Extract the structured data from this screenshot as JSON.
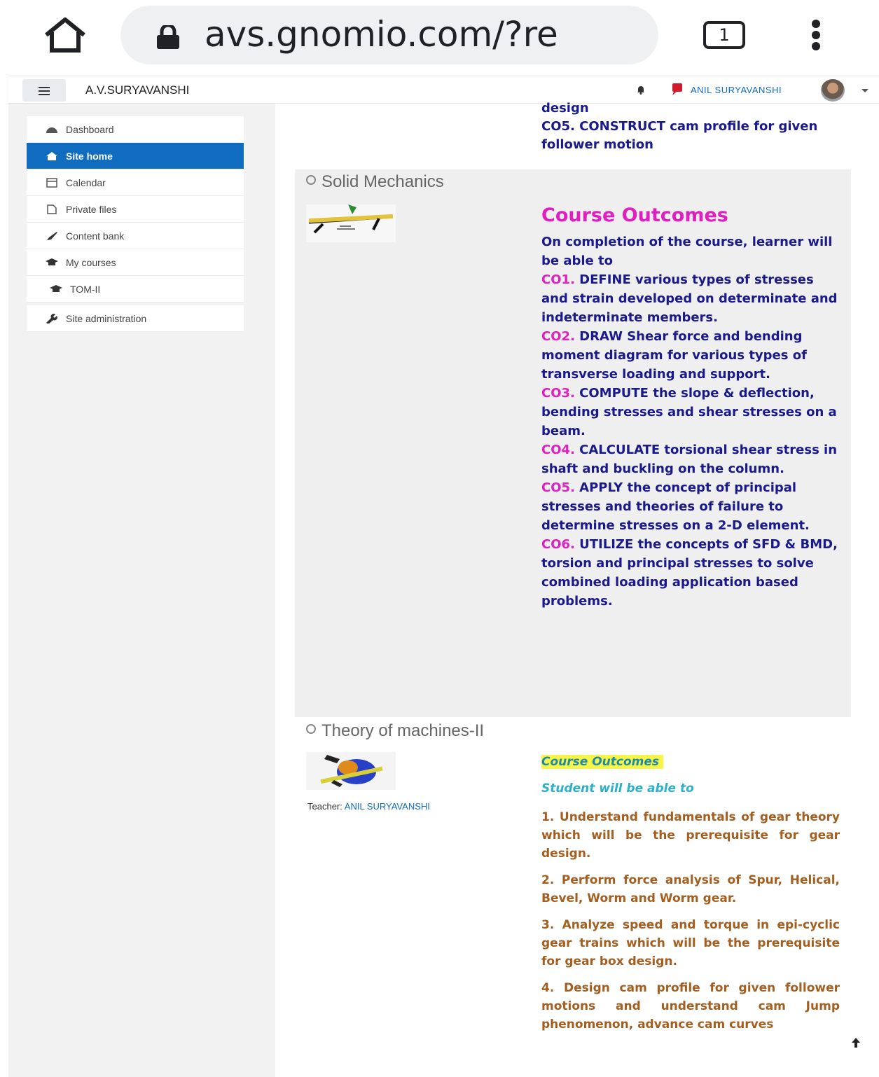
{
  "browser": {
    "url": "avs.gnomio.com/?re",
    "tab_count": "1"
  },
  "navbar": {
    "site_name": "A.V.SURYAVANSHI",
    "user_name": "ANIL SURYAVANSHI"
  },
  "drawer": {
    "items": [
      {
        "label": "Dashboard",
        "icon": "dashboard-icon"
      },
      {
        "label": "Site home",
        "icon": "home-icon"
      },
      {
        "label": "Calendar",
        "icon": "calendar-icon"
      },
      {
        "label": "Private files",
        "icon": "file-icon"
      },
      {
        "label": "Content bank",
        "icon": "brush-icon"
      },
      {
        "label": "My courses",
        "icon": "graduation-cap-icon"
      },
      {
        "label": "TOM-II",
        "icon": "graduation-cap-icon"
      }
    ],
    "admin_item": {
      "label": "Site administration",
      "icon": "wrench-icon"
    }
  },
  "previous_course": {
    "line1": "design",
    "line2": "CO5. CONSTRUCT cam profile for given follower motion"
  },
  "courses": [
    {
      "title": "Solid Mechanics",
      "heading": "Course Outcomes",
      "intro": "On completion of the course, learner will be able to",
      "outcomes": [
        {
          "code": "CO1.",
          "text": "DEFINE various types of stresses and strain developed on determinate and indeterminate members."
        },
        {
          "code": "CO2.",
          "text": "DRAW Shear force and bending moment diagram for various types of transverse loading and support."
        },
        {
          "code": "CO3.",
          "text": "COMPUTE the slope & deflection, bending stresses and shear stresses on a beam."
        },
        {
          "code": "CO4.",
          "text": "CALCULATE torsional shear stress in shaft and buckling on the column."
        },
        {
          "code": "CO5.",
          "text": "APPLY the concept of principal stresses and theories of failure to determine stresses on a 2-D element."
        },
        {
          "code": "CO6.",
          "text": "UTILIZE the concepts of SFD & BMD, torsion and principal stresses to solve combined loading application based problems."
        }
      ]
    },
    {
      "title": "Theory of machines-II",
      "teacher_label": "Teacher:",
      "teacher_name": "ANIL SURYAVANSHI",
      "heading": "Course Outcomes",
      "subheading": "Student will be able to",
      "outcomes": [
        "1.   Understand fundamentals of gear theory which will be the prerequisite for gear design.",
        "2.  Perform force analysis of Spur, Helical, Bevel, Worm and Worm gear.",
        "3.  Analyze speed and torque in epi-cyclic gear trains which will be the prerequisite for gear box design.",
        "4.  Design cam profile for given follower motions and understand cam Jump phenomenon, advance cam curves"
      ]
    }
  ],
  "colors": {
    "primary": "#0f6cbf",
    "co_code": "#e01fc0",
    "co_text": "#1a1a8c",
    "tom_text": "#a35e20",
    "highlight": "#f6f548"
  }
}
